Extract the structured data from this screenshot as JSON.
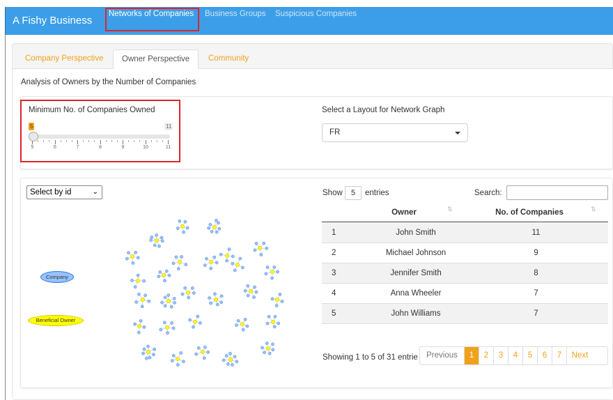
{
  "navbar": {
    "brand": "A Fishy Business",
    "links": [
      "Networks of Companies",
      "Business Groups",
      "Suspicious Companies"
    ]
  },
  "tabs": [
    "Company Perspective",
    "Owner Perspective",
    "Community"
  ],
  "analysis_title": "Analysis of Owners by the Number of Companies",
  "slider": {
    "label": "Minimum No. of Companies Owned",
    "value": 5,
    "min": 5,
    "max": 11,
    "value_label": "5",
    "max_label": "11",
    "tick_labels": [
      "5",
      "6",
      "7",
      "8",
      "9",
      "10",
      "11"
    ]
  },
  "layout": {
    "label": "Select a Layout for Network Graph",
    "selected": "FR"
  },
  "graph": {
    "select_label": "Select by id",
    "legend_company": "Company",
    "legend_owner": "Beneficial Owner",
    "colors": {
      "company": "#97c2fc",
      "owner": "#ffff00"
    }
  },
  "table": {
    "show_label": "Show",
    "entries_value": "5",
    "entries_label": "entries",
    "search_label": "Search:",
    "columns": [
      "Owner",
      "No. of Companies"
    ],
    "rows": [
      [
        "1",
        "John Smith",
        "11"
      ],
      [
        "2",
        "Michael Johnson",
        "9"
      ],
      [
        "3",
        "Jennifer Smith",
        "8"
      ],
      [
        "4",
        "Anna Wheeler",
        "7"
      ],
      [
        "5",
        "John Williams",
        "7"
      ]
    ],
    "info": "Showing 1 to 5 of 31 entrie",
    "pagination": [
      "Previous",
      "1",
      "2",
      "3",
      "4",
      "5",
      "6",
      "7",
      "Next"
    ]
  },
  "accent_color": "#f0a21a",
  "highlight_color": "#e0242a"
}
